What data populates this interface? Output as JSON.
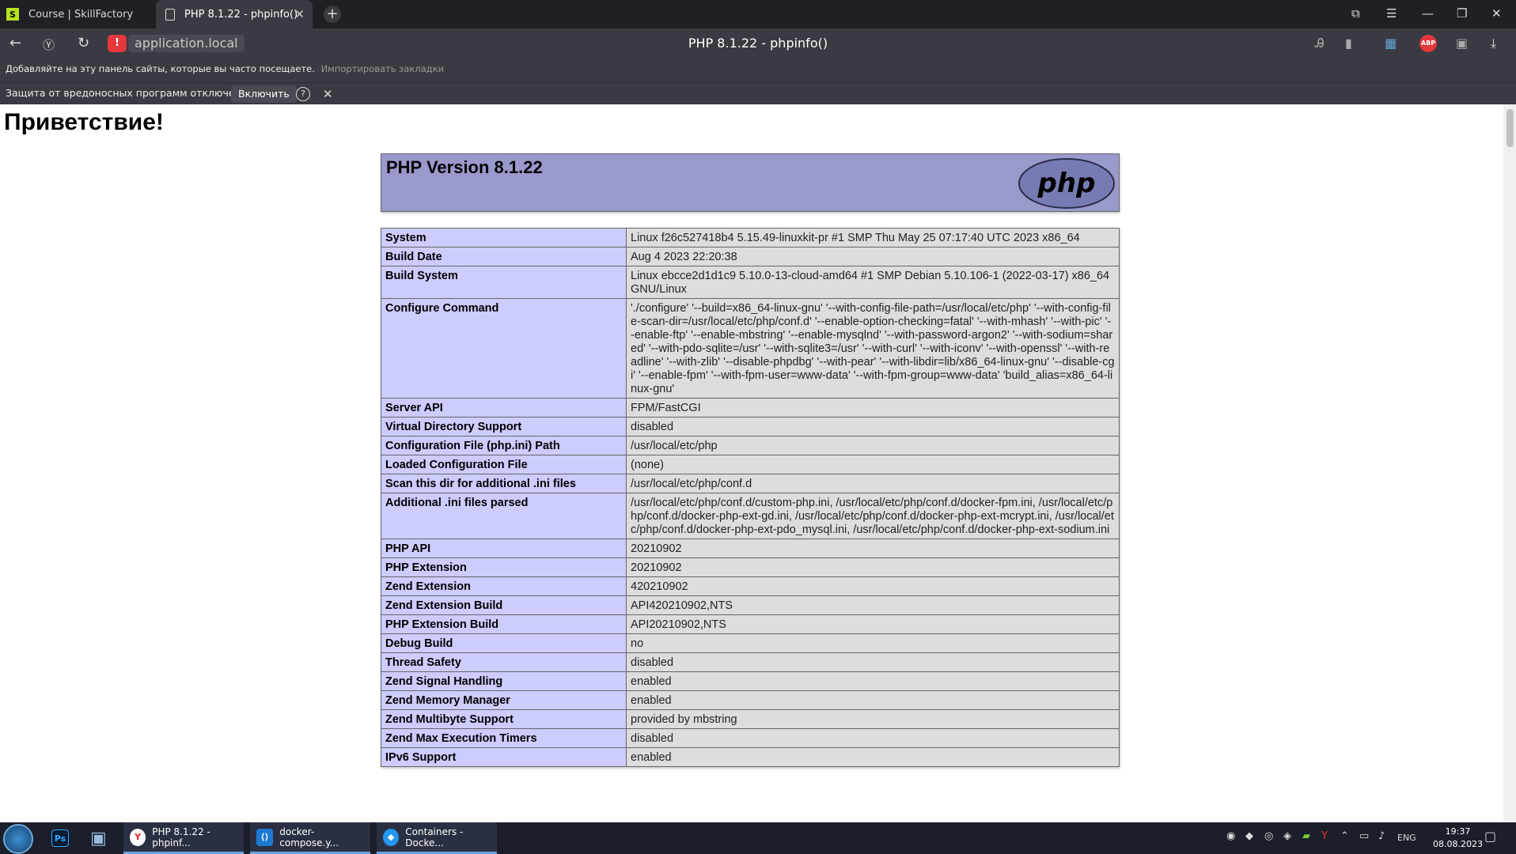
{
  "browser": {
    "tabs": [
      {
        "label": "Course | SkillFactory"
      },
      {
        "label": "PHP 8.1.22 - phpinfo()"
      }
    ],
    "address": "application.local",
    "page_title": "PHP 8.1.22 - phpinfo()",
    "bookmarks_hint": "Добавляйте на эту панель сайты, которые вы часто посещаете.",
    "import_bookmarks": "Импортировать закладки",
    "protection_notice": "Защита от вредоносных программ отключена",
    "enable_label": "Включить",
    "abp_label": "ABP"
  },
  "page": {
    "greeting": "Приветствие!",
    "php_version": "PHP Version 8.1.22",
    "logo_text": "php",
    "info_rows": [
      {
        "key": "System",
        "value": "Linux f26c527418b4 5.15.49-linuxkit-pr #1 SMP Thu May 25 07:17:40 UTC 2023 x86_64"
      },
      {
        "key": "Build Date",
        "value": "Aug 4 2023 22:20:38"
      },
      {
        "key": "Build System",
        "value": "Linux ebcce2d1d1c9 5.10.0-13-cloud-amd64 #1 SMP Debian 5.10.106-1 (2022-03-17) x86_64 GNU/Linux"
      },
      {
        "key": "Configure Command",
        "value": "'./configure' '--build=x86_64-linux-gnu' '--with-config-file-path=/usr/local/etc/php' '--with-config-file-scan-dir=/usr/local/etc/php/conf.d' '--enable-option-checking=fatal' '--with-mhash' '--with-pic' '--enable-ftp' '--enable-mbstring' '--enable-mysqlnd' '--with-password-argon2' '--with-sodium=shared' '--with-pdo-sqlite=/usr' '--with-sqlite3=/usr' '--with-curl' '--with-iconv' '--with-openssl' '--with-readline' '--with-zlib' '--disable-phpdbg' '--with-pear' '--with-libdir=lib/x86_64-linux-gnu' '--disable-cgi' '--enable-fpm' '--with-fpm-user=www-data' '--with-fpm-group=www-data' 'build_alias=x86_64-linux-gnu'"
      },
      {
        "key": "Server API",
        "value": "FPM/FastCGI"
      },
      {
        "key": "Virtual Directory Support",
        "value": "disabled"
      },
      {
        "key": "Configuration File (php.ini) Path",
        "value": "/usr/local/etc/php"
      },
      {
        "key": "Loaded Configuration File",
        "value": "(none)"
      },
      {
        "key": "Scan this dir for additional .ini files",
        "value": "/usr/local/etc/php/conf.d"
      },
      {
        "key": "Additional .ini files parsed",
        "value": "/usr/local/etc/php/conf.d/custom-php.ini, /usr/local/etc/php/conf.d/docker-fpm.ini, /usr/local/etc/php/conf.d/docker-php-ext-gd.ini, /usr/local/etc/php/conf.d/docker-php-ext-mcrypt.ini, /usr/local/etc/php/conf.d/docker-php-ext-pdo_mysql.ini, /usr/local/etc/php/conf.d/docker-php-ext-sodium.ini"
      },
      {
        "key": "PHP API",
        "value": "20210902"
      },
      {
        "key": "PHP Extension",
        "value": "20210902"
      },
      {
        "key": "Zend Extension",
        "value": "420210902"
      },
      {
        "key": "Zend Extension Build",
        "value": "API420210902,NTS"
      },
      {
        "key": "PHP Extension Build",
        "value": "API20210902,NTS"
      },
      {
        "key": "Debug Build",
        "value": "no"
      },
      {
        "key": "Thread Safety",
        "value": "disabled"
      },
      {
        "key": "Zend Signal Handling",
        "value": "enabled"
      },
      {
        "key": "Zend Memory Manager",
        "value": "enabled"
      },
      {
        "key": "Zend Multibyte Support",
        "value": "provided by mbstring"
      },
      {
        "key": "Zend Max Execution Timers",
        "value": "disabled"
      },
      {
        "key": "IPv6 Support",
        "value": "enabled"
      }
    ]
  },
  "taskbar": {
    "apps": [
      {
        "label": "PHP 8.1.22 - phpinf..."
      },
      {
        "label": "docker-compose.y..."
      },
      {
        "label": "Containers - Docke..."
      }
    ],
    "ps_label": "Ps",
    "lang": "ENG",
    "time": "19:37",
    "date": "08.08.2023"
  }
}
